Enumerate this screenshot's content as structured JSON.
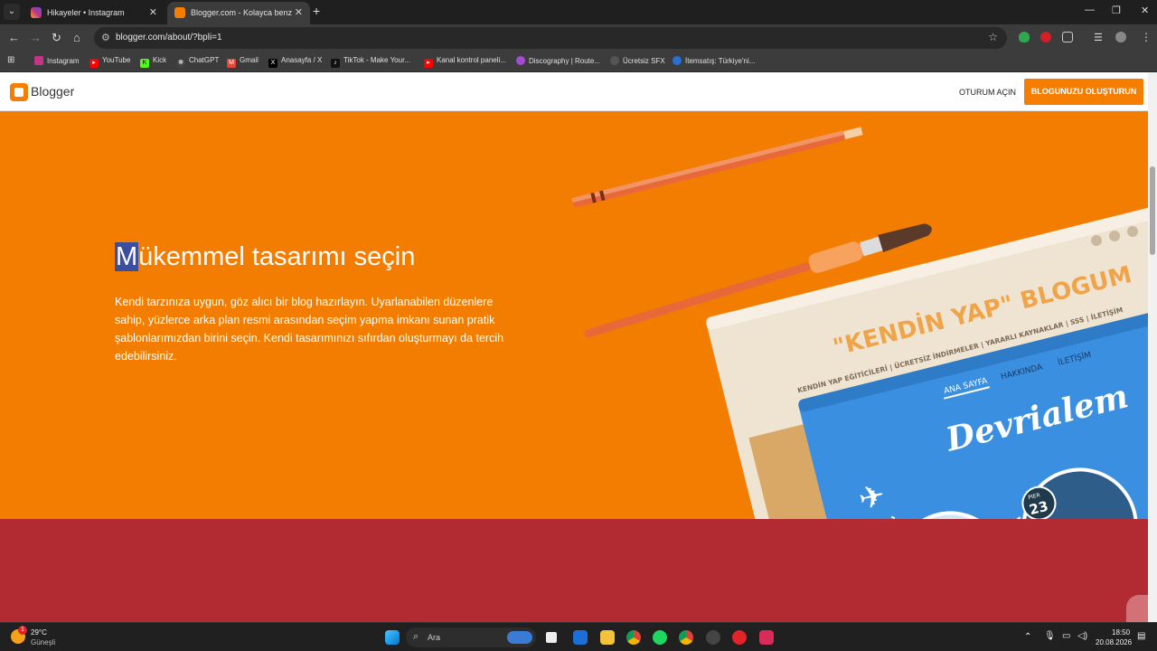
{
  "browser": {
    "tabs": [
      {
        "title": "Hikayeler • Instagram",
        "close": "✕"
      },
      {
        "title": "Blogger.com - Kolayca benzersi",
        "close": "✕"
      }
    ],
    "url": "blogger.com/about/?bpli=1",
    "bookmarks": [
      {
        "label": "Instagram",
        "color": "#c13584"
      },
      {
        "label": "YouTube",
        "color": "#ff0000"
      },
      {
        "label": "Kick",
        "color": "#53fc18"
      },
      {
        "label": "ChatGPT",
        "color": "#444444"
      },
      {
        "label": "Gmail",
        "color": "#ea4335"
      },
      {
        "label": "Anasayfa / X",
        "color": "#000000"
      },
      {
        "label": "TikTok - Make Your...",
        "color": "#111111"
      },
      {
        "label": "Kanal kontrol paneli...",
        "color": "#ff0000"
      },
      {
        "label": "Discography | Route...",
        "color": "#a24bd4"
      },
      {
        "label": "Ücretsiz SFX",
        "color": "#555555"
      },
      {
        "label": "İtemsatış: Türkiye'ni...",
        "color": "#2a6fd6"
      }
    ]
  },
  "blogger": {
    "brand": "Blogger",
    "signin": "OTURUM AÇIN",
    "create": "BLOGUNUZU OLUŞTURUN",
    "heading_sel": "M",
    "heading_rest": "ükemmel tasarımı seçin",
    "description": "Kendi tarzınıza uygun, göz alıcı bir blog hazırlayın. Uyarlanabilen düzenlere sahip, yüzlerce arka plan resmi arasından seçim yapma imkanı sunan pratik şablonlarımızdan birini seçin. Kendi tasarımınızı sıfırdan oluşturmayı da tercih edebilirsiniz.",
    "colors": {
      "orange": "#f37d00",
      "red": "#b22a32"
    },
    "illustration": {
      "back_title": "\"KENDİN YAP\" BLOGUM",
      "back_nav": "KENDİN YAP EĞİTİCİLERİ | ÜCRETSİZ İNDİRMELER | YARARLI KAYNAKLAR | SSS | İLETİŞİM",
      "front_nav": [
        "ANA SAYFA",
        "HAKKINDA",
        "İLETİŞİM"
      ],
      "front_title": "Devrialem",
      "badge_top": "PIER",
      "badge_num": "23"
    }
  },
  "taskbar": {
    "temp": "29°C",
    "weather": "Güneşli",
    "weather_badge": "1",
    "search": "Ara",
    "time": "18:50",
    "date": "20.08.2026"
  }
}
